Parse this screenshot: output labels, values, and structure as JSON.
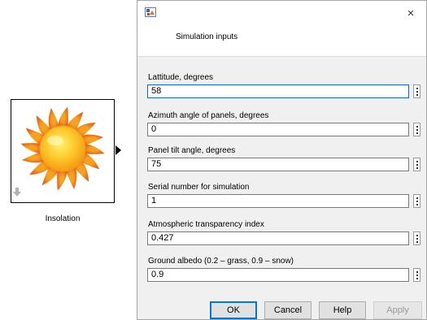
{
  "block": {
    "label": "Insolation",
    "icon": "sun-icon",
    "sun_color": "#fdb813",
    "ray_color": "#f7931e"
  },
  "dialog": {
    "icon": "simulink-app-icon",
    "close_symbol": "×",
    "header_title": "Simulation inputs",
    "fields": [
      {
        "label": "Lattitude, degrees",
        "value": "58",
        "focused": true
      },
      {
        "label": "Azimuth angle of panels, degrees",
        "value": "0"
      },
      {
        "label": "Panel tilt angle, degrees",
        "value": "75"
      },
      {
        "label": "Serial number for simulation",
        "value": "1"
      },
      {
        "label": "Atmospheric transparency index",
        "value": "0.427"
      },
      {
        "label": "Ground albedo (0.2 – grass, 0.9 – snow)",
        "value": "0.9"
      }
    ],
    "buttons": {
      "ok": "OK",
      "cancel": "Cancel",
      "help": "Help",
      "apply": "Apply"
    },
    "focus_color": "#1565c0"
  }
}
